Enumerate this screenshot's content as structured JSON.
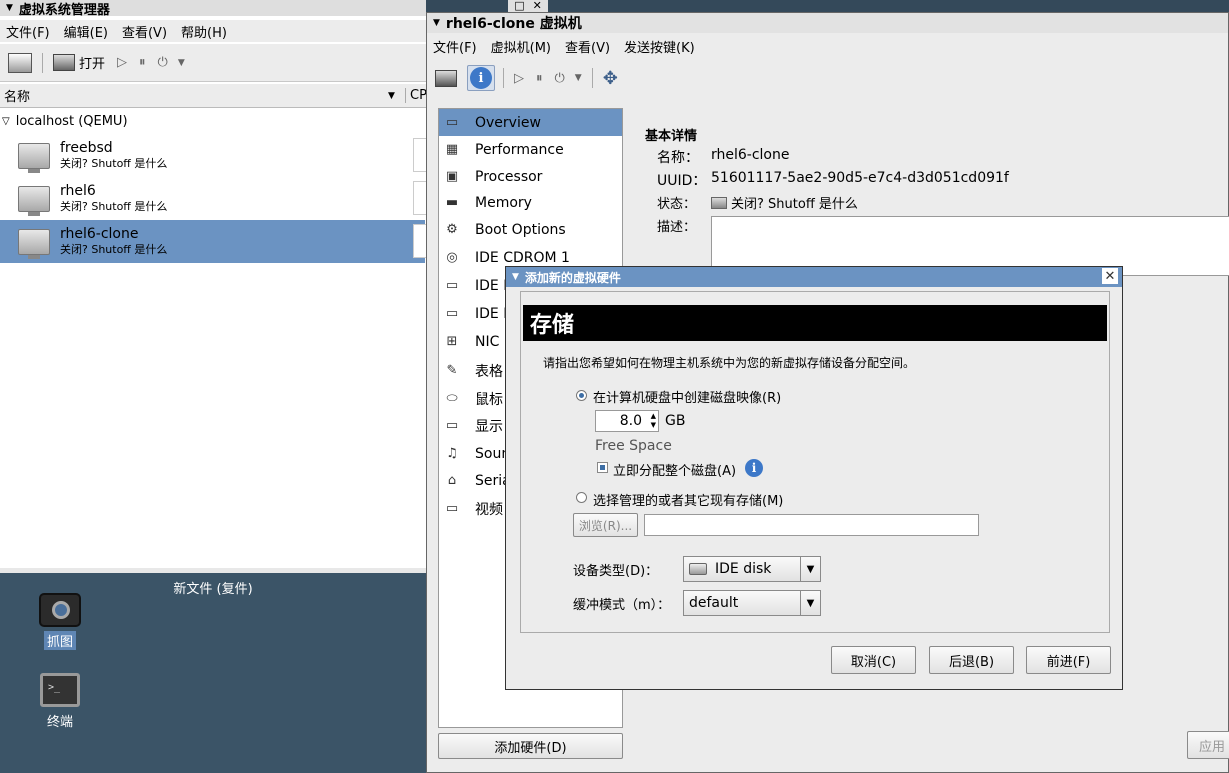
{
  "manager": {
    "title": "虚拟系统管理器",
    "menu": [
      "文件(F)",
      "编辑(E)",
      "查看(V)",
      "帮助(H)"
    ],
    "open_label": "打开",
    "column_name": "名称",
    "column_cpu": "CP",
    "host": "localhost (QEMU)",
    "vms": [
      {
        "name": "freebsd",
        "status": "关闭? Shutoff 是什么"
      },
      {
        "name": "rhel6",
        "status": "关闭? Shutoff 是什么"
      },
      {
        "name": "rhel6-clone",
        "status": "关闭? Shutoff 是什么"
      }
    ]
  },
  "taskbar": {
    "title": "新文件 (复件)"
  },
  "desktop": {
    "icons": [
      {
        "label": "抓图",
        "icon": "camera-icon"
      },
      {
        "label": "终端",
        "icon": "terminal-icon"
      }
    ]
  },
  "vmwin": {
    "title": "rhel6-clone 虚拟机",
    "menu": [
      "文件(F)",
      "虚拟机(M)",
      "查看(V)",
      "发送按键(K)"
    ],
    "hardware": [
      {
        "label": "Overview",
        "icon": "monitor-icon"
      },
      {
        "label": "Performance",
        "icon": "performance-icon"
      },
      {
        "label": "Processor",
        "icon": "processor-icon"
      },
      {
        "label": "Memory",
        "icon": "memory-icon"
      },
      {
        "label": "Boot Options",
        "icon": "gears-icon"
      },
      {
        "label": "IDE CDROM 1",
        "icon": "cdrom-icon"
      },
      {
        "label": "IDE D",
        "icon": "disk-icon"
      },
      {
        "label": "IDE D",
        "icon": "disk-icon"
      },
      {
        "label": "NIC :",
        "icon": "nic-icon"
      },
      {
        "label": "表格",
        "icon": "tablet-icon"
      },
      {
        "label": "鼠标",
        "icon": "mouse-icon"
      },
      {
        "label": "显示",
        "icon": "display-icon"
      },
      {
        "label": "Soun",
        "icon": "sound-icon"
      },
      {
        "label": "Seria",
        "icon": "serial-icon"
      },
      {
        "label": "视频",
        "icon": "video-icon"
      }
    ],
    "add_hw": "添加硬件(D)",
    "apply": "应用",
    "details": {
      "heading": "基本详情",
      "name_label": "名称：",
      "name": "rhel6-clone",
      "uuid_label": "UUID：",
      "uuid": "51601117-5ae2-90d5-e7c4-d3d051cd091f",
      "status_label": "状态：",
      "status": "关闭? Shutoff 是什么",
      "desc_label": "描述："
    }
  },
  "dialog": {
    "title": "添加新的虚拟硬件",
    "banner": "存储",
    "intro": "请指出您希望如何在物理主机系统中为您的新虚拟存储设备分配空间。",
    "opt_create": "在计算机硬盘中创建磁盘映像(R)",
    "size": "8.0",
    "unit": "GB",
    "free_space": "Free Space",
    "alloc_now": "立即分配整个磁盘(A)",
    "opt_existing": "选择管理的或者其它现有存储(M)",
    "browse": "浏览(R)...",
    "device_type_label": "设备类型(D)：",
    "device_type": "IDE disk",
    "cache_label": "缓冲模式（m）：",
    "cache": "default",
    "cancel": "取消(C)",
    "back": "后退(B)",
    "forward": "前进(F)"
  }
}
